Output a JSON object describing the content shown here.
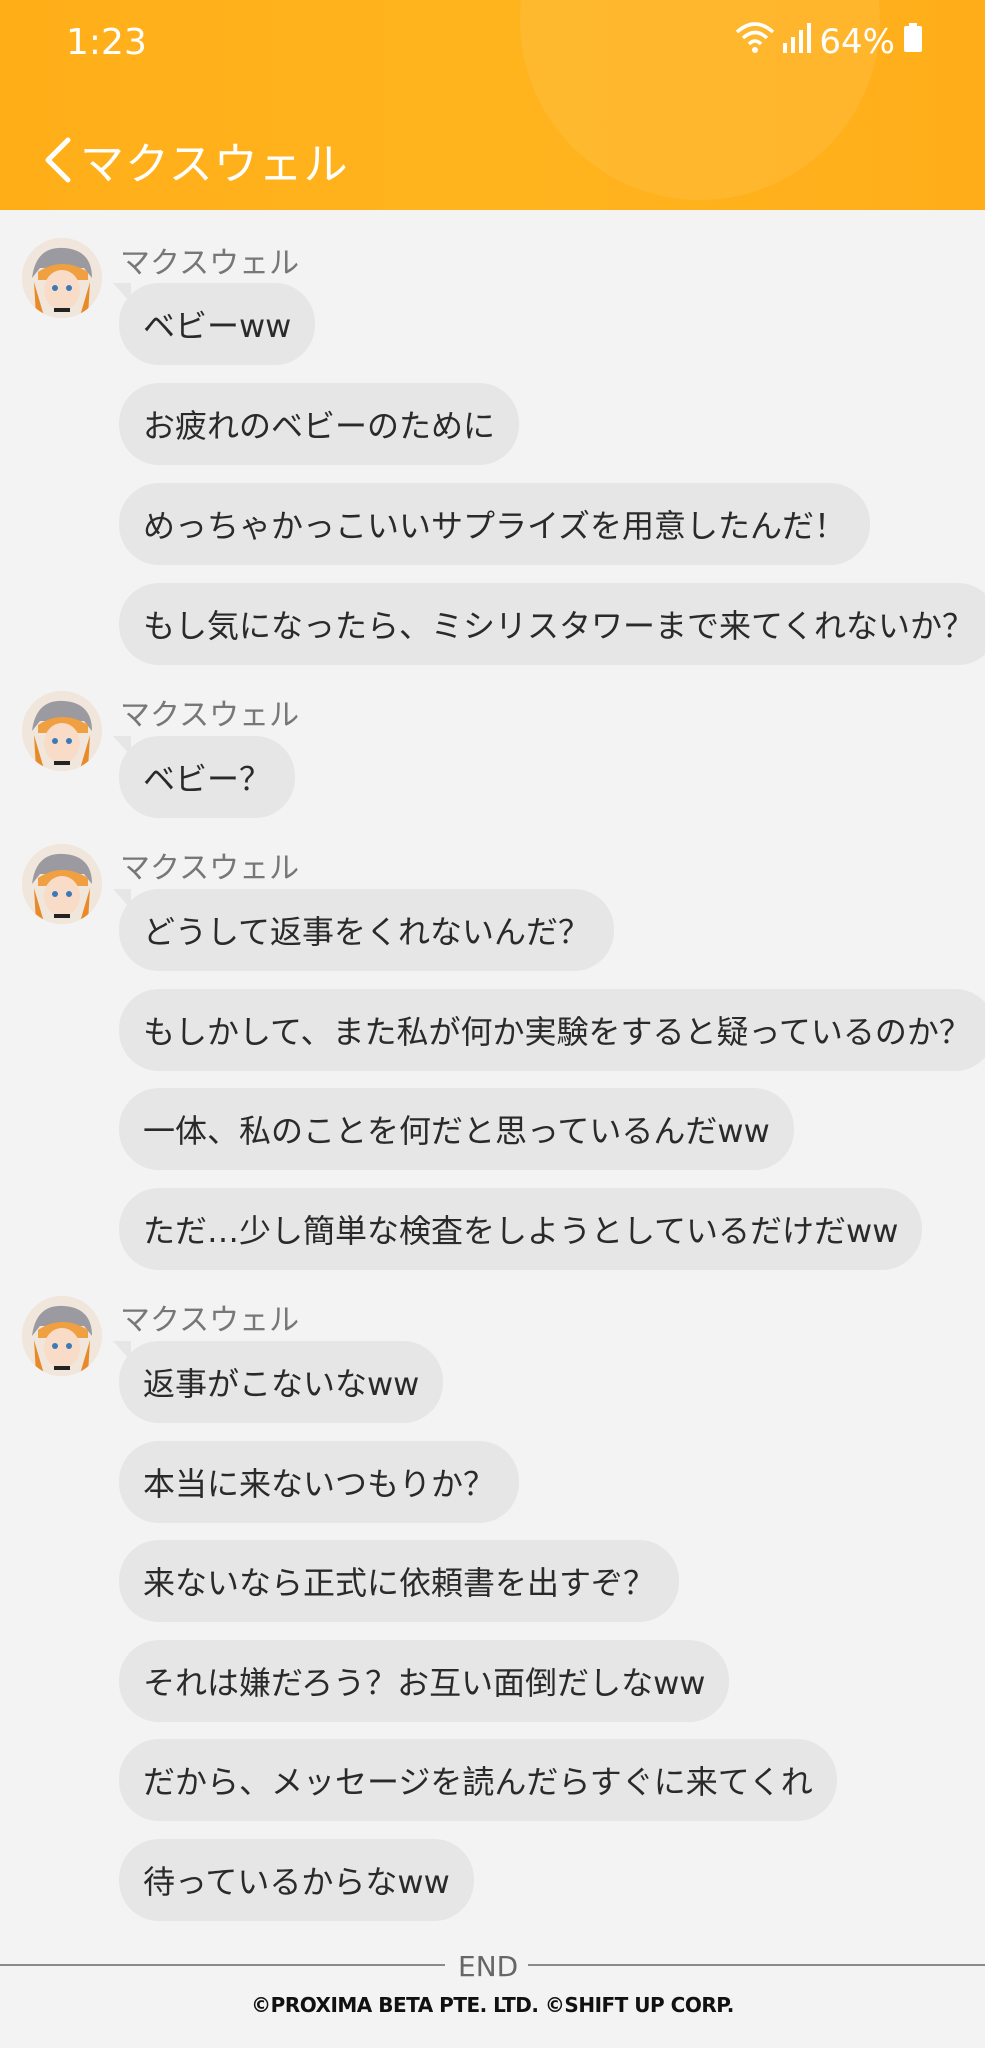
{
  "status_bar": {
    "time": "1:23",
    "battery": "64%"
  },
  "header": {
    "title": "マクスウェル",
    "accent_color": "#ffae18"
  },
  "icons": {
    "back": "chevron-left-icon",
    "wifi": "wifi-icon",
    "signal": "signal-icon",
    "battery": "battery-icon"
  },
  "groups": [
    {
      "sender": "マクスウェル",
      "messages": [
        "ベビーww",
        "お疲れのベビーのために",
        "めっちゃかっこいいサプライズを用意したんだ！",
        "もし気になったら、ミシリスタワーまで来てくれないか？"
      ]
    },
    {
      "sender": "マクスウェル",
      "messages": [
        "ベビー？"
      ]
    },
    {
      "sender": "マクスウェル",
      "messages": [
        "どうして返事をくれないんだ？",
        "もしかして、また私が何か実験をすると疑っているのか？",
        "一体、私のことを何だと思っているんだww",
        "ただ…少し簡単な検査をしようとしているだけだww"
      ]
    },
    {
      "sender": "マクスウェル",
      "messages": [
        "返事がこないなww",
        "本当に来ないつもりか？",
        "来ないなら正式に依頼書を出すぞ？",
        "それは嫌だろう？お互い面倒だしなww",
        "だから、メッセージを読んだらすぐに来てくれ",
        "待っているからなww"
      ]
    }
  ],
  "footer": {
    "end_label": "END",
    "copyright": "©PROXIMA BETA PTE. LTD. ©SHIFT UP CORP."
  }
}
